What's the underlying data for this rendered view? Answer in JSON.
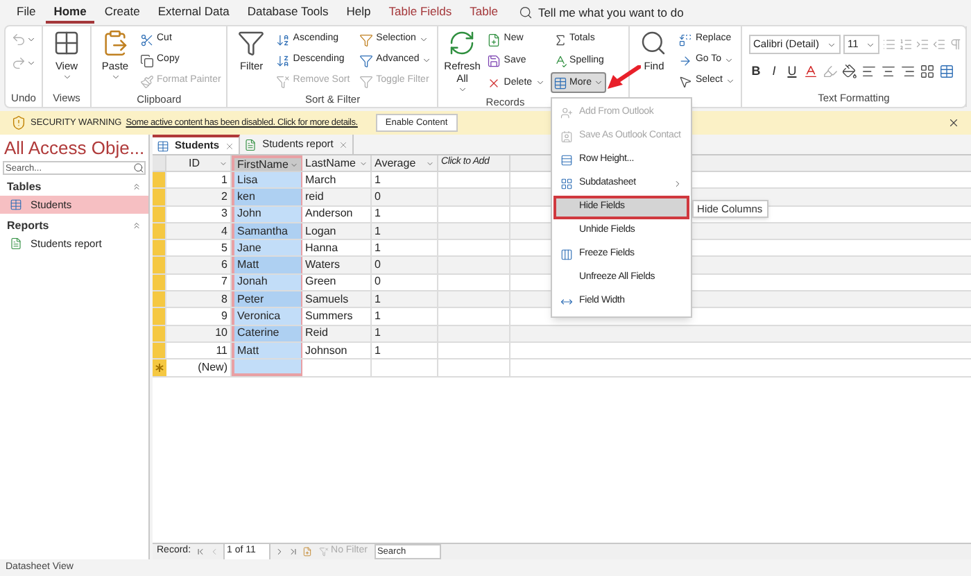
{
  "menu_tabs": [
    {
      "label": "File",
      "selected": false,
      "kind": "normal"
    },
    {
      "label": "Home",
      "selected": true,
      "kind": "normal"
    },
    {
      "label": "Create",
      "selected": false,
      "kind": "normal"
    },
    {
      "label": "External Data",
      "selected": false,
      "kind": "normal"
    },
    {
      "label": "Database Tools",
      "selected": false,
      "kind": "normal"
    },
    {
      "label": "Help",
      "selected": false,
      "kind": "normal"
    },
    {
      "label": "Table Fields",
      "selected": false,
      "kind": "contextual"
    },
    {
      "label": "Table",
      "selected": false,
      "kind": "contextual"
    }
  ],
  "tell_me": {
    "placeholder": "Tell me what you want to do"
  },
  "ribbon": {
    "undo": {
      "label": "Undo",
      "undo_disabled": true,
      "redo_disabled": true
    },
    "views": {
      "label": "Views",
      "view": "View"
    },
    "clipboard": {
      "label": "Clipboard",
      "paste": "Paste",
      "items": [
        {
          "label": "Cut",
          "disabled": false
        },
        {
          "label": "Copy",
          "disabled": false
        },
        {
          "label": "Format Painter",
          "disabled": true
        }
      ]
    },
    "sort_filter": {
      "label": "Sort & Filter",
      "filter": "Filter",
      "items": [
        {
          "label": "Ascending",
          "disabled": false,
          "dropdown": false
        },
        {
          "label": "Descending",
          "disabled": false,
          "dropdown": false
        },
        {
          "label": "Remove Sort",
          "disabled": true,
          "dropdown": false
        },
        {
          "label": "Selection",
          "disabled": false,
          "dropdown": true
        },
        {
          "label": "Advanced",
          "disabled": false,
          "dropdown": true
        },
        {
          "label": "Toggle Filter",
          "disabled": true,
          "dropdown": false
        }
      ]
    },
    "records": {
      "label": "Records",
      "refresh": "Refresh All",
      "items": [
        {
          "label": "New",
          "dropdown": false,
          "pressed": false
        },
        {
          "label": "Save",
          "dropdown": false,
          "pressed": false
        },
        {
          "label": "Delete",
          "dropdown": true,
          "pressed": false
        },
        {
          "label": "Totals",
          "dropdown": false,
          "pressed": false
        },
        {
          "label": "Spelling",
          "dropdown": false,
          "pressed": false
        },
        {
          "label": "More",
          "dropdown": true,
          "pressed": true
        }
      ]
    },
    "find": {
      "find": "Find",
      "items": [
        {
          "label": "Replace",
          "dropdown": false
        },
        {
          "label": "Go To",
          "dropdown": true
        },
        {
          "label": "Select",
          "dropdown": true
        }
      ]
    },
    "text_formatting": {
      "label": "Text Formatting",
      "font": "Calibri (Detail)",
      "size": "11",
      "styles": [
        "B",
        "I",
        "U"
      ]
    }
  },
  "security_bar": {
    "title": "SECURITY WARNING",
    "message": "Some active content has been disabled. Click for more details.",
    "button": "Enable Content"
  },
  "nav_pane": {
    "title": "All Access Obje...",
    "search": {
      "placeholder": "Search..."
    },
    "groups": [
      {
        "label": "Tables",
        "items": [
          {
            "label": "Students",
            "selected": true,
            "kind": "table"
          }
        ]
      },
      {
        "label": "Reports",
        "items": [
          {
            "label": "Students report",
            "selected": false,
            "kind": "report"
          }
        ]
      }
    ]
  },
  "document_tabs": [
    {
      "label": "Students",
      "selected": true,
      "kind": "table"
    },
    {
      "label": "Students report",
      "selected": false,
      "kind": "report"
    }
  ],
  "table": {
    "columns": [
      {
        "label": "ID",
        "selected": false,
        "kind": "field"
      },
      {
        "label": "FirstName",
        "selected": true,
        "kind": "field"
      },
      {
        "label": "LastName",
        "selected": false,
        "kind": "field"
      },
      {
        "label": "Average",
        "selected": false,
        "kind": "field"
      },
      {
        "label": "Click to Add",
        "selected": false,
        "kind": "add"
      }
    ],
    "rows": [
      [
        "1",
        "Lisa",
        "March",
        "1"
      ],
      [
        "2",
        "ken",
        "reid",
        "0"
      ],
      [
        "3",
        "John",
        "Anderson",
        "1"
      ],
      [
        "4",
        "Samantha",
        "Logan",
        "1"
      ],
      [
        "5",
        "Jane",
        "Hanna",
        "1"
      ],
      [
        "6",
        "Matt",
        "Waters",
        "0"
      ],
      [
        "7",
        "Jonah",
        "Green",
        "0"
      ],
      [
        "8",
        "Peter",
        "Samuels",
        "1"
      ],
      [
        "9",
        "Veronica",
        "Summers",
        "1"
      ],
      [
        "10",
        "Caterine",
        "Reid",
        "1"
      ],
      [
        "11",
        "Matt",
        "Johnson",
        "1"
      ]
    ],
    "new_row": "(New)"
  },
  "record_nav": {
    "label": "Record:",
    "position": "1 of 11",
    "filter": "No Filter",
    "search": {
      "placeholder": "Search"
    }
  },
  "more_menu": {
    "items": [
      {
        "label": "Add From Outlook",
        "disabled": true,
        "selected": false,
        "submenu": false
      },
      {
        "label": "Save As Outlook Contact",
        "disabled": true,
        "selected": false,
        "submenu": false
      },
      {
        "label": "Row Height...",
        "disabled": false,
        "selected": false,
        "submenu": false
      },
      {
        "label": "Subdatasheet",
        "disabled": false,
        "selected": false,
        "submenu": true
      },
      {
        "label": "Hide Fields",
        "disabled": false,
        "selected": true,
        "submenu": false
      },
      {
        "label": "Unhide Fields",
        "disabled": false,
        "selected": false,
        "submenu": false
      },
      {
        "label": "Freeze Fields",
        "disabled": false,
        "selected": false,
        "submenu": false
      },
      {
        "label": "Unfreeze All Fields",
        "disabled": false,
        "selected": false,
        "submenu": false
      },
      {
        "label": "Field Width",
        "disabled": false,
        "selected": false,
        "submenu": false
      }
    ],
    "tooltip": "Hide Columns"
  },
  "status_bar": {
    "text": "Datasheet View"
  }
}
